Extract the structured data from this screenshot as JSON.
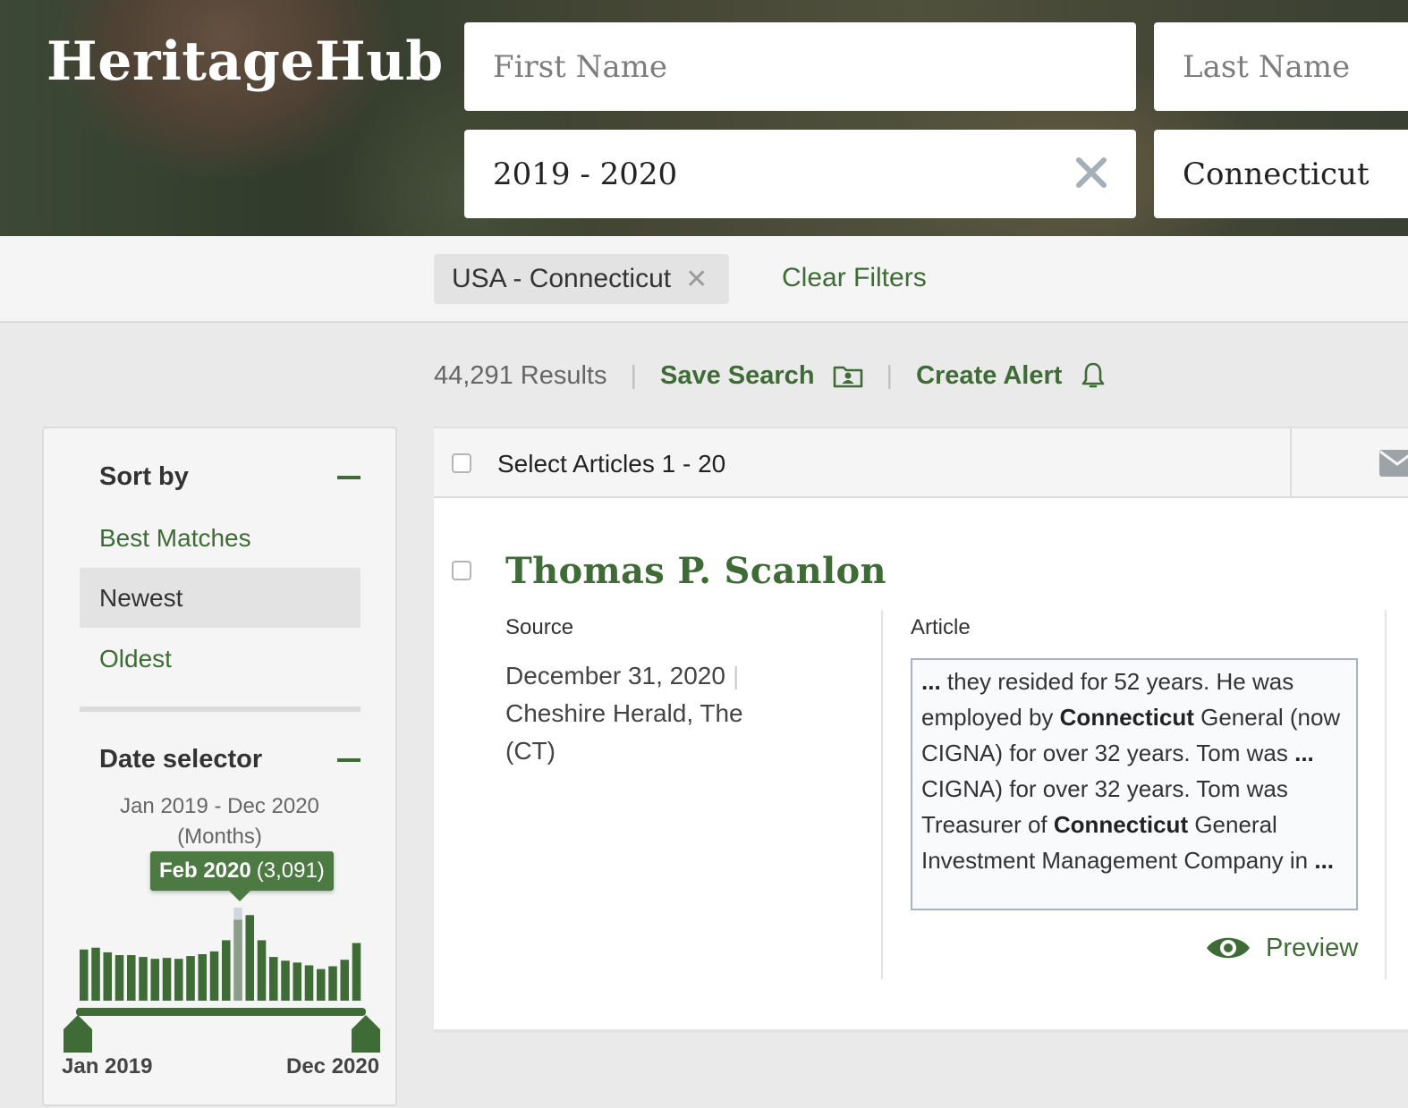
{
  "header": {
    "logo": "HeritageHub",
    "first_name_placeholder": "First Name",
    "last_name_placeholder": "Last Name",
    "date_value": "2019 - 2020",
    "location_value": "Connecticut"
  },
  "filters": {
    "chip_label": "USA - Connecticut",
    "chip_remove": "✕",
    "clear_label": "Clear Filters"
  },
  "results": {
    "count_label": "44,291 Results",
    "separator": "|",
    "save_search_label": "Save Search",
    "create_alert_label": "Create Alert"
  },
  "sidebar": {
    "sort_title": "Sort by",
    "sort_options": [
      "Best Matches",
      "Newest",
      "Oldest"
    ],
    "active_sort": "Newest",
    "date_title": "Date selector",
    "range_line1": "Jan 2019 - Dec 2020",
    "range_line2": "(Months)",
    "tooltip_month": "Feb 2020",
    "tooltip_count": "(3,091)",
    "axis_start": "Jan 2019",
    "axis_end": "Dec 2020",
    "histogram_relative_values": [
      0.55,
      0.57,
      0.52,
      0.49,
      0.49,
      0.47,
      0.45,
      0.46,
      0.45,
      0.48,
      0.5,
      0.53,
      0.65,
      0.87,
      0.92,
      0.65,
      0.47,
      0.43,
      0.41,
      0.38,
      0.34,
      0.37,
      0.44,
      0.62
    ],
    "highlighted_index": 13,
    "colors": {
      "bar": "#3f6b36",
      "highlight": "#8e9c8c",
      "highlight_bg": "#cfd6de"
    }
  },
  "articles": {
    "select_label": "Select Articles 1 - 20",
    "items": [
      {
        "title": "Thomas P. Scanlon",
        "source_label": "Source",
        "date": "December 31, 2020",
        "pipe": "|",
        "publication": "Cheshire Herald, The (CT)",
        "article_label": "Article",
        "preview_label": "Preview"
      }
    ]
  },
  "theme": {
    "accent": "#3f6b36",
    "panel_bg": "#f5f5f5",
    "page_bg": "#eaeaea"
  }
}
